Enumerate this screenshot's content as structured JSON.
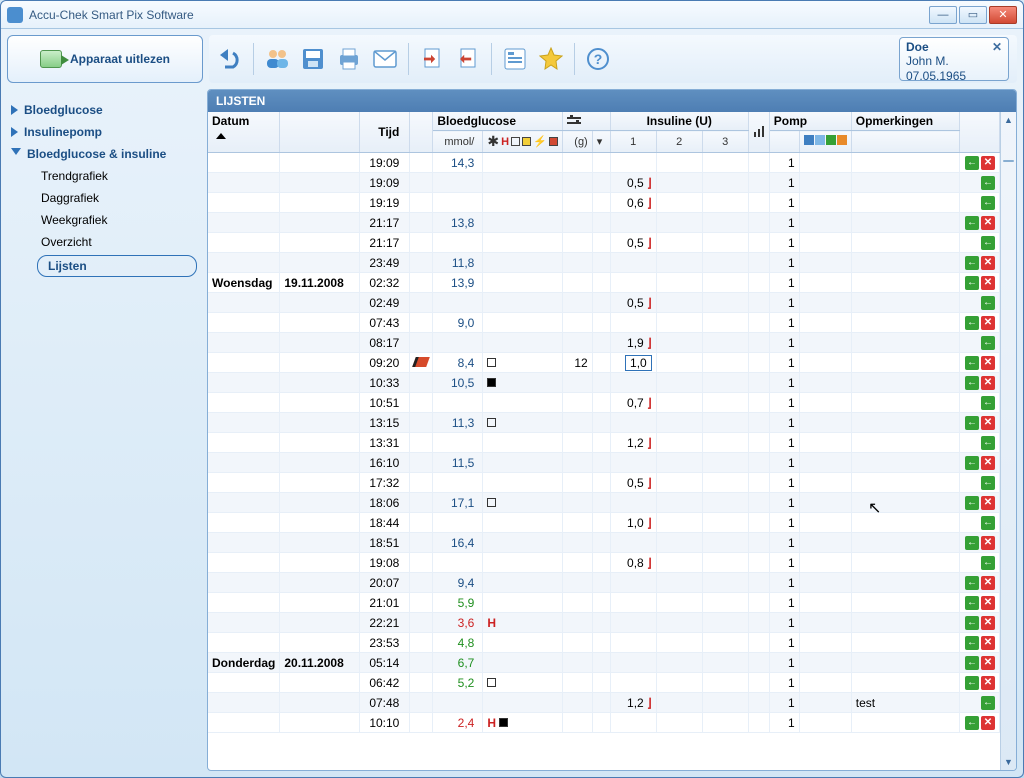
{
  "app": {
    "title": "Accu-Chek Smart Pix Software"
  },
  "read_device": "Apparaat uitlezen",
  "nav": {
    "bloedglucose": "Bloedglucose",
    "insulinepomp": "Insulinepomp",
    "bg_insuline": "Bloedglucose & insuline",
    "trendgrafiek": "Trendgrafiek",
    "daggrafiek": "Daggrafiek",
    "weekgrafiek": "Weekgrafiek",
    "overzicht": "Overzicht",
    "lijsten": "Lijsten"
  },
  "user": {
    "last": "Doe",
    "first": "John M.",
    "dob": "07.05.1965"
  },
  "list_title": "LIJSTEN",
  "headers": {
    "datum": "Datum",
    "tijd": "Tijd",
    "bg": "Bloedglucose",
    "bg_unit": "mmol/",
    "g": "(g)",
    "ins": "Insuline (U)",
    "ins1": "1",
    "ins2": "2",
    "ins3": "3",
    "pomp": "Pomp",
    "opm": "Opmerkingen"
  },
  "rows": [
    {
      "time": "19:09",
      "bg": "14,3",
      "bg_color": "blue",
      "pump": "1",
      "alt": 0,
      "act": "gx"
    },
    {
      "time": "19:09",
      "ins1": "0,5",
      "bolus": true,
      "pump": "1",
      "alt": 1,
      "act": "g"
    },
    {
      "time": "19:19",
      "ins1": "0,6",
      "bolus": true,
      "pump": "1",
      "alt": 0,
      "act": "g"
    },
    {
      "time": "21:17",
      "bg": "13,8",
      "bg_color": "blue",
      "pump": "1",
      "alt": 1,
      "act": "gx"
    },
    {
      "time": "21:17",
      "ins1": "0,5",
      "bolus": true,
      "pump": "1",
      "alt": 0,
      "act": "g"
    },
    {
      "time": "23:49",
      "bg": "11,8",
      "bg_color": "blue",
      "pump": "1",
      "alt": 1,
      "act": "gx"
    },
    {
      "day": "Woensdag",
      "date": "19.11.2008",
      "time": "02:32",
      "bg": "13,9",
      "bg_color": "blue",
      "pump": "1",
      "alt": 0,
      "head": true,
      "act": "gx"
    },
    {
      "time": "02:49",
      "ins1": "0,5",
      "bolus": true,
      "pump": "1",
      "alt": 1,
      "act": "g"
    },
    {
      "time": "07:43",
      "bg": "9,0",
      "bg_color": "blue",
      "pump": "1",
      "alt": 0,
      "act": "gx"
    },
    {
      "time": "08:17",
      "ins1": "1,9",
      "bolus": true,
      "pump": "1",
      "alt": 1,
      "act": "g"
    },
    {
      "time": "09:20",
      "bg": "8,4",
      "bg_color": "blue",
      "flag": "open",
      "carbs": "12",
      "ins1": "1,0",
      "editing": true,
      "mark": "pencil",
      "pump": "1",
      "alt": 0,
      "act": "gx"
    },
    {
      "time": "10:33",
      "bg": "10,5",
      "bg_color": "blue",
      "flag": "filled",
      "pump": "1",
      "alt": 1,
      "act": "gx"
    },
    {
      "time": "10:51",
      "ins1": "0,7",
      "bolus": true,
      "pump": "1",
      "alt": 0,
      "act": "g"
    },
    {
      "time": "13:15",
      "bg": "11,3",
      "bg_color": "blue",
      "flag": "open",
      "pump": "1",
      "alt": 1,
      "act": "gx"
    },
    {
      "time": "13:31",
      "ins1": "1,2",
      "bolus": true,
      "pump": "1",
      "alt": 0,
      "act": "g"
    },
    {
      "time": "16:10",
      "bg": "11,5",
      "bg_color": "blue",
      "pump": "1",
      "alt": 1,
      "act": "gx"
    },
    {
      "time": "17:32",
      "ins1": "0,5",
      "bolus": true,
      "pump": "1",
      "alt": 0,
      "act": "g"
    },
    {
      "time": "18:06",
      "bg": "17,1",
      "bg_color": "blue",
      "flag": "open",
      "pump": "1",
      "alt": 1,
      "act": "gx"
    },
    {
      "time": "18:44",
      "ins1": "1,0",
      "bolus": true,
      "pump": "1",
      "alt": 0,
      "act": "g"
    },
    {
      "time": "18:51",
      "bg": "16,4",
      "bg_color": "blue",
      "pump": "1",
      "alt": 1,
      "act": "gx"
    },
    {
      "time": "19:08",
      "ins1": "0,8",
      "bolus": true,
      "pump": "1",
      "alt": 0,
      "act": "g"
    },
    {
      "time": "20:07",
      "bg": "9,4",
      "bg_color": "blue",
      "pump": "1",
      "alt": 1,
      "act": "gx"
    },
    {
      "time": "21:01",
      "bg": "5,9",
      "bg_color": "green",
      "pump": "1",
      "alt": 0,
      "act": "gx"
    },
    {
      "time": "22:21",
      "bg": "3,6",
      "bg_color": "red",
      "flag": "H",
      "pump": "1",
      "alt": 1,
      "act": "gx"
    },
    {
      "time": "23:53",
      "bg": "4,8",
      "bg_color": "green",
      "pump": "1",
      "alt": 0,
      "act": "gx"
    },
    {
      "day": "Donderdag",
      "date": "20.11.2008",
      "time": "05:14",
      "bg": "6,7",
      "bg_color": "green",
      "pump": "1",
      "alt": 1,
      "head": true,
      "act": "gx"
    },
    {
      "time": "06:42",
      "bg": "5,2",
      "bg_color": "green",
      "flag": "open",
      "pump": "1",
      "alt": 0,
      "act": "gx"
    },
    {
      "time": "07:48",
      "ins1": "1,2",
      "bolus": true,
      "comment": "test",
      "pump": "1",
      "alt": 1,
      "act": "g"
    },
    {
      "time": "10:10",
      "bg": "2,4",
      "bg_color": "red",
      "flag": "Hfilled",
      "pump": "1",
      "alt": 0,
      "act": "gx"
    }
  ]
}
